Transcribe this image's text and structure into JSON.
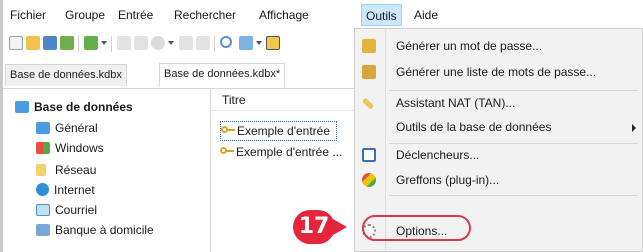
{
  "menubar": {
    "items": [
      "Fichier",
      "Groupe",
      "Entrée",
      "Rechercher",
      "Affichage",
      "Outils",
      "Aide"
    ],
    "open_item": "Outils"
  },
  "tabs": [
    "Base de données.kdbx",
    "Base de données.kdbx*"
  ],
  "tree": {
    "root": "Base de données",
    "groups": [
      "Général",
      "Windows",
      "Réseau",
      "Internet",
      "Courriel",
      "Banque à domicile"
    ]
  },
  "list": {
    "column_title": "Titre",
    "rows": [
      "Exemple d'entrée",
      "Exemple d'entrée ..."
    ]
  },
  "tools_menu": {
    "items": [
      {
        "label": "Générer un mot de passe...",
        "icon": "password-generator-icon",
        "submenu": false
      },
      {
        "label": "Générer une liste de mots de passe...",
        "icon": "password-list-icon",
        "submenu": false
      },
      {
        "label": "Assistant NAT (TAN)...",
        "icon": "wand-icon",
        "submenu": false
      },
      {
        "label": "Outils de la base de données",
        "icon": "",
        "submenu": true
      },
      {
        "label": "Déclencheurs...",
        "icon": "triggers-icon",
        "submenu": false
      },
      {
        "label": "Greffons (plug-in)...",
        "icon": "plugins-icon",
        "submenu": false
      },
      {
        "label": "Options...",
        "icon": "options-gear-icon",
        "submenu": false
      }
    ]
  },
  "annotation": {
    "step": "17",
    "color": "#e4253c"
  },
  "colors": {
    "menu_open": "#cce8ff",
    "key": "#d9a520",
    "folder": "#4a9de0"
  }
}
